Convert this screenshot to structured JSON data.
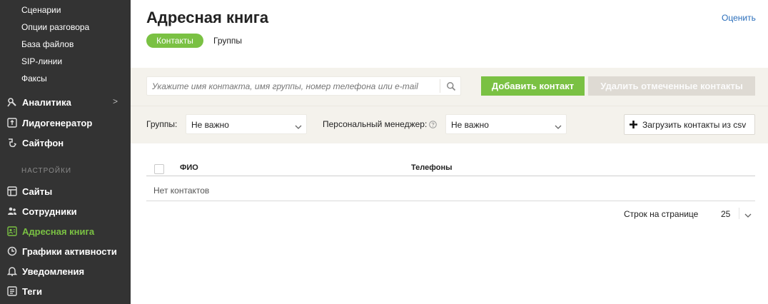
{
  "sidebar": {
    "sub_items": [
      {
        "label": "Сценарии"
      },
      {
        "label": "Опции разговора"
      },
      {
        "label": "База файлов"
      },
      {
        "label": "SIP-линии"
      },
      {
        "label": "Факсы"
      }
    ],
    "items_top": [
      {
        "label": "Аналитика",
        "icon": "analytics-icon",
        "arrow": ">"
      },
      {
        "label": "Лидогенератор",
        "icon": "leadgen-icon"
      },
      {
        "label": "Сайтфон",
        "icon": "sitephone-icon"
      }
    ],
    "settings_label": "НАСТРОЙКИ",
    "items_settings": [
      {
        "label": "Сайты",
        "icon": "sites-icon"
      },
      {
        "label": "Сотрудники",
        "icon": "users-icon"
      },
      {
        "label": "Адресная книга",
        "icon": "address-book-icon",
        "active": true
      },
      {
        "label": "Графики активности",
        "icon": "clock-icon"
      },
      {
        "label": "Уведомления",
        "icon": "bell-icon"
      },
      {
        "label": "Теги",
        "icon": "tags-icon"
      }
    ]
  },
  "header": {
    "title": "Адресная книга",
    "rate_link": "Оценить"
  },
  "tabs": [
    {
      "label": "Контакты",
      "active": true
    },
    {
      "label": "Группы",
      "active": false
    }
  ],
  "toolbar": {
    "search_placeholder": "Укажите имя контакта, имя группы, номер телефона или e-mail",
    "add_button": "Добавить контакт",
    "delete_button": "Удалить отмеченные контакты"
  },
  "filters": {
    "groups_label": "Группы:",
    "groups_value": "Не важно",
    "manager_label": "Персональный менеджер:",
    "manager_value": "Не важно",
    "upload_button": "Загрузить контакты из csv"
  },
  "table": {
    "columns": [
      "ФИО",
      "Телефоны"
    ],
    "empty_text": "Нет контактов"
  },
  "pagination": {
    "label": "Строк на странице",
    "value": "25"
  },
  "colors": {
    "accent": "#7ac143",
    "sidebar_bg": "#333333",
    "link": "#2a6ebb",
    "band_bg": "#f4f2ec"
  }
}
